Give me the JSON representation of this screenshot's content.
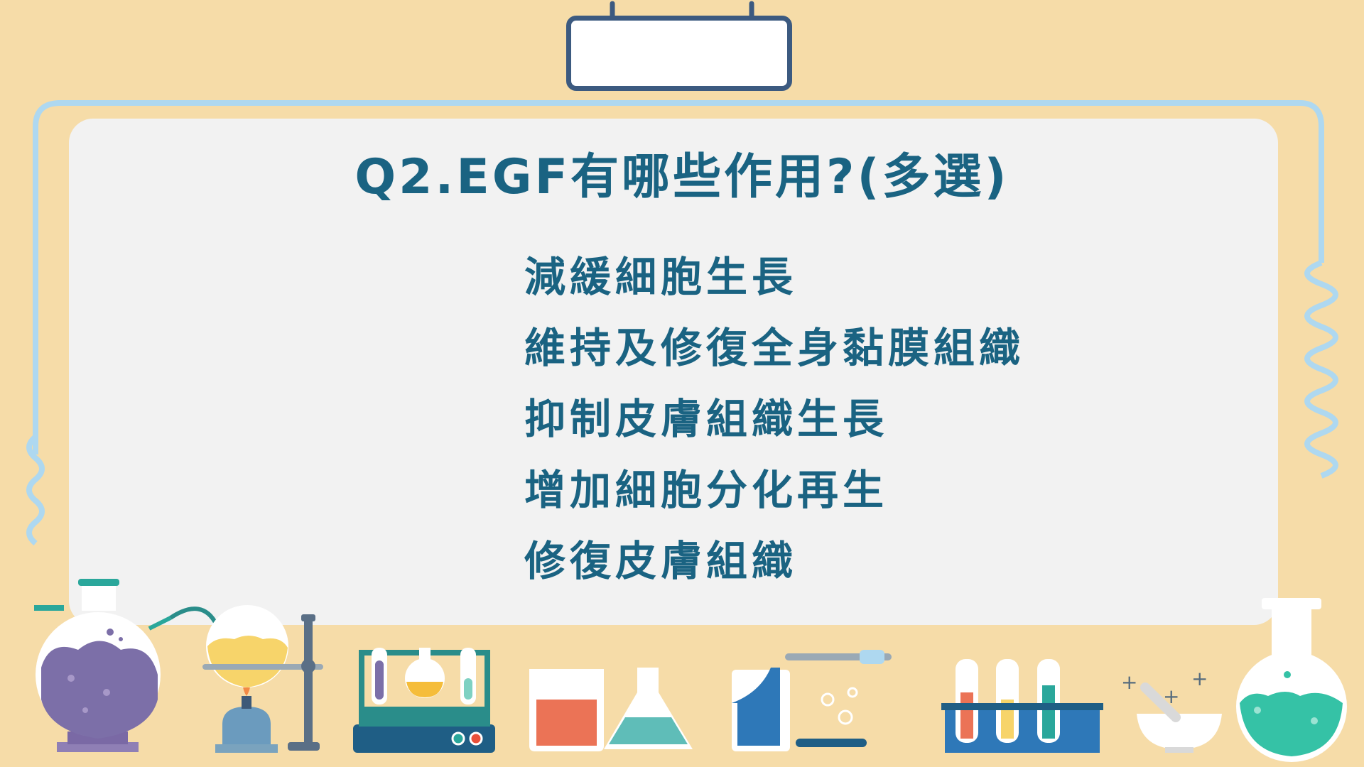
{
  "slide": {
    "question": "Q2.EGF有哪些作用?(多選)",
    "options": [
      "減緩細胞生長",
      "維持及修復全身黏膜組織",
      "抑制皮膚組織生長",
      "增加細胞分化再生",
      "修復皮膚組織"
    ]
  },
  "colors": {
    "background": "#f6dca8",
    "board": "#f2f2f2",
    "text": "#1a6382",
    "frame_line": "#aed8f0"
  }
}
